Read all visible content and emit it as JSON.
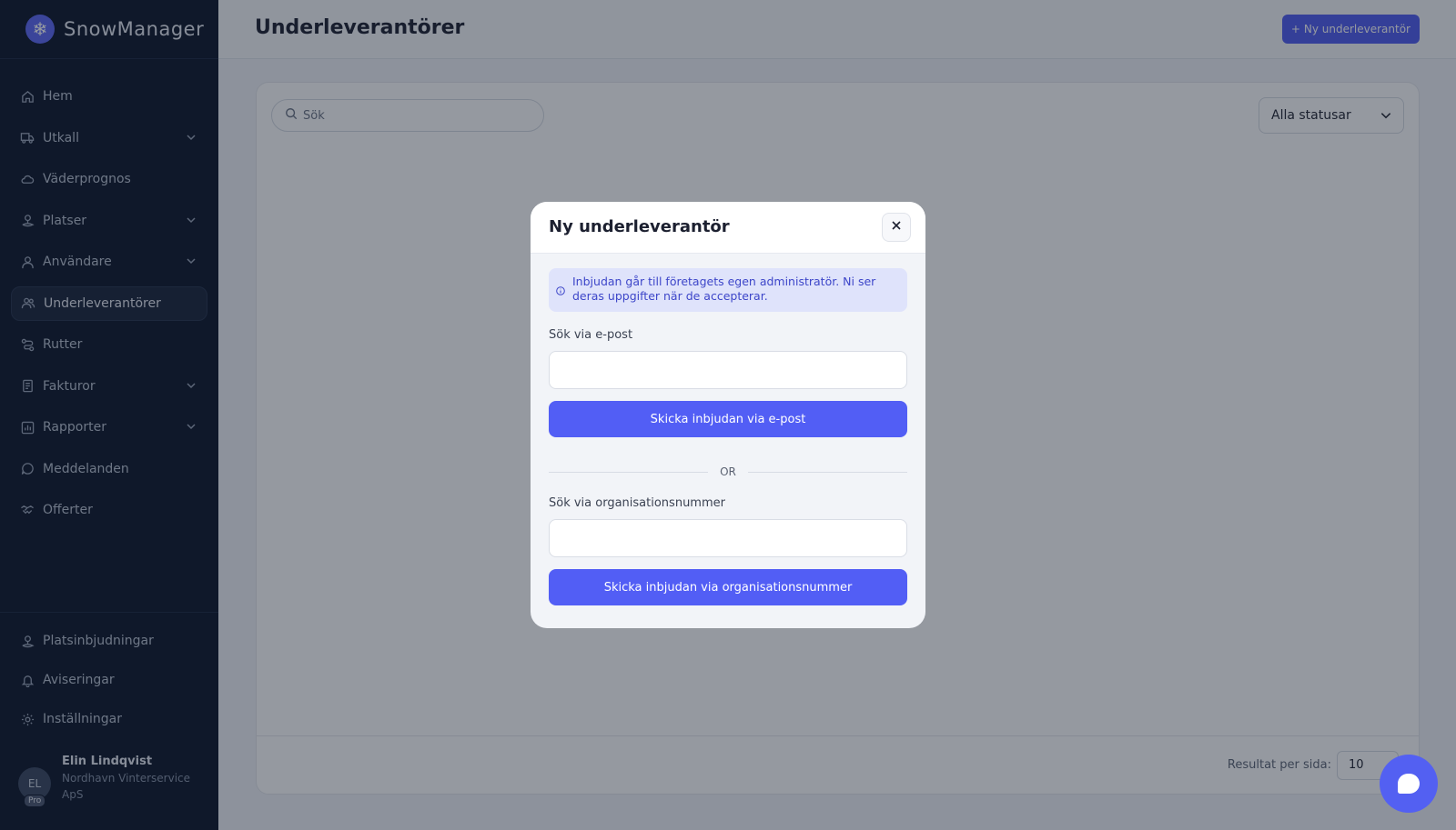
{
  "app": {
    "name": "SnowManager"
  },
  "sidebar": {
    "items": [
      {
        "label": "Hem",
        "icon": "home-icon",
        "has_children": false
      },
      {
        "label": "Utkall",
        "icon": "truck-icon",
        "has_children": true
      },
      {
        "label": "Väderprognos",
        "icon": "cloud-icon",
        "has_children": false
      },
      {
        "label": "Platser",
        "icon": "map-pin-icon",
        "has_children": true
      },
      {
        "label": "Användare",
        "icon": "user-icon",
        "has_children": true
      },
      {
        "label": "Underleverantörer",
        "icon": "users-icon",
        "has_children": false,
        "active": true
      },
      {
        "label": "Rutter",
        "icon": "route-icon",
        "has_children": false
      },
      {
        "label": "Fakturor",
        "icon": "invoice-icon",
        "has_children": true
      },
      {
        "label": "Rapporter",
        "icon": "chart-icon",
        "has_children": true
      },
      {
        "label": "Meddelanden",
        "icon": "message-icon",
        "has_children": false
      },
      {
        "label": "Offerter",
        "icon": "handshake-icon",
        "has_children": false
      }
    ],
    "bottom_items": [
      {
        "label": "Platsinbjudningar",
        "icon": "map-pin-icon"
      },
      {
        "label": "Aviseringar",
        "icon": "bell-icon"
      },
      {
        "label": "Inställningar",
        "icon": "gear-icon"
      }
    ],
    "user": {
      "initials": "EL",
      "badge": "Pro",
      "name": "Elin Lindqvist",
      "company": "Nordhavn Vinterservice ApS"
    }
  },
  "header": {
    "title": "Underleverantörer",
    "new_button_label": "Ny underleverantör"
  },
  "list": {
    "search_placeholder": "Sök",
    "status_filter": "Alla statusar",
    "results_per_page_label": "Resultat per sida:",
    "results_per_page_value": "10"
  },
  "modal": {
    "title": "Ny underleverantör",
    "info_text": "Inbjudan går till företagets egen administratör. Ni ser deras uppgifter när de accepterar.",
    "email_label": "Sök via e-post",
    "email_value": "",
    "email_button": "Skicka inbjudan via e-post",
    "divider_text": "OR",
    "org_label": "Sök via organisationsnummer",
    "org_value": "",
    "org_button": "Skicka inbjudan via organisationsnummer"
  },
  "colors": {
    "sidebar_bg": "#0b1528",
    "accent": "#525ef5",
    "info_bg": "#dfe3fb",
    "info_text": "#3d46c9"
  }
}
